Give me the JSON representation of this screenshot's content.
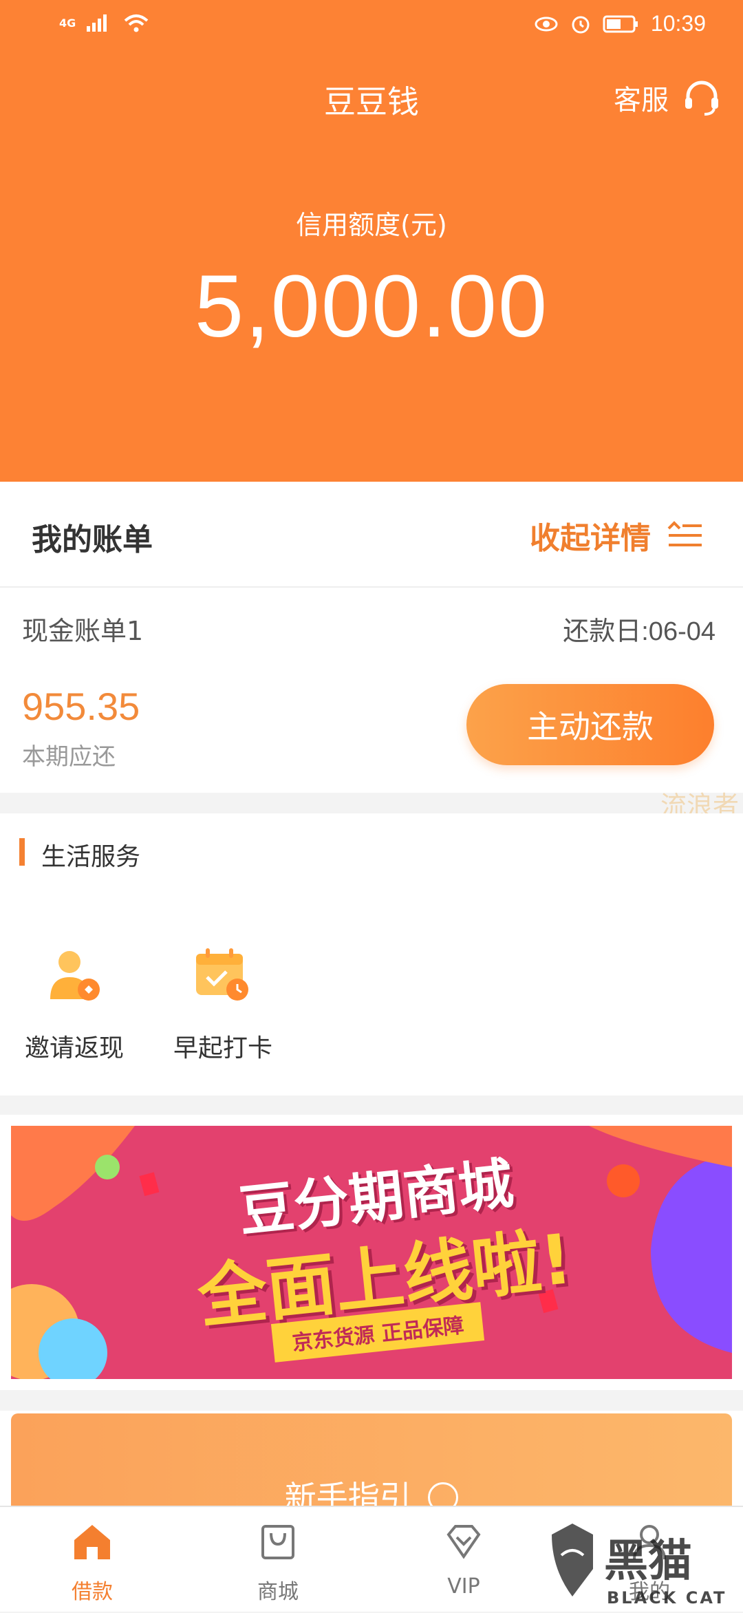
{
  "status_bar": {
    "network": "4G",
    "time": "10:39"
  },
  "header": {
    "title": "豆豆钱",
    "service_label": "客服",
    "credit_label": "信用额度(元)",
    "credit_amount": "5,000.00"
  },
  "bill": {
    "section_title": "我的账单",
    "collapse_label": "收起详情",
    "bill_name": "现金账单1",
    "due_date": "还款日:06-04",
    "amount": "955.35",
    "amount_label": "本期应还",
    "repay_button": "主动还款"
  },
  "watermark": "流浪者",
  "life_services": {
    "title": "生活服务",
    "items": [
      {
        "label": "邀请返现",
        "icon": "invite-cashback-icon"
      },
      {
        "label": "早起打卡",
        "icon": "calendar-checkin-icon"
      }
    ]
  },
  "banner": {
    "line1": "豆分期商城",
    "line2": "全面上线啦!",
    "line3": "京东货源 正品保障"
  },
  "guide": {
    "label": "新手指引"
  },
  "tabs": [
    {
      "label": "借款",
      "icon": "home-icon",
      "active": true
    },
    {
      "label": "商城",
      "icon": "shopping-bag-icon",
      "active": false
    },
    {
      "label": "VIP",
      "icon": "diamond-icon",
      "active": false
    },
    {
      "label": "我的",
      "icon": "user-icon",
      "active": false
    }
  ],
  "corner_logo": {
    "cn": "黑猫",
    "en": "BLACK CAT"
  },
  "colors": {
    "brand_orange": "#fd8234",
    "accent_text": "#f07f2e",
    "banner_pink": "#e3416e"
  }
}
